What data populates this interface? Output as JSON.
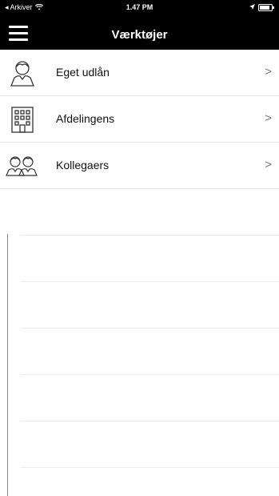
{
  "status_bar": {
    "back_label": "◂ Arkiver",
    "wifi_icon": "wifi-icon",
    "time": "1.47 PM",
    "location_icon": "location-arrow-icon",
    "battery_icon": "battery-icon"
  },
  "navbar": {
    "menu_icon": "hamburger-menu-icon",
    "title": "Værktøjer"
  },
  "menu": {
    "items": [
      {
        "label": "Eget udlån",
        "icon": "person-icon",
        "chevron": ">"
      },
      {
        "label": "Afdelingens",
        "icon": "building-icon",
        "chevron": ">"
      },
      {
        "label": "Kollegaers",
        "icon": "people-icon",
        "chevron": ">"
      }
    ]
  },
  "colors": {
    "header_bg": "#000000",
    "header_text": "#ffffff",
    "divider": "#e6e6e6",
    "chevron": "#777777"
  }
}
